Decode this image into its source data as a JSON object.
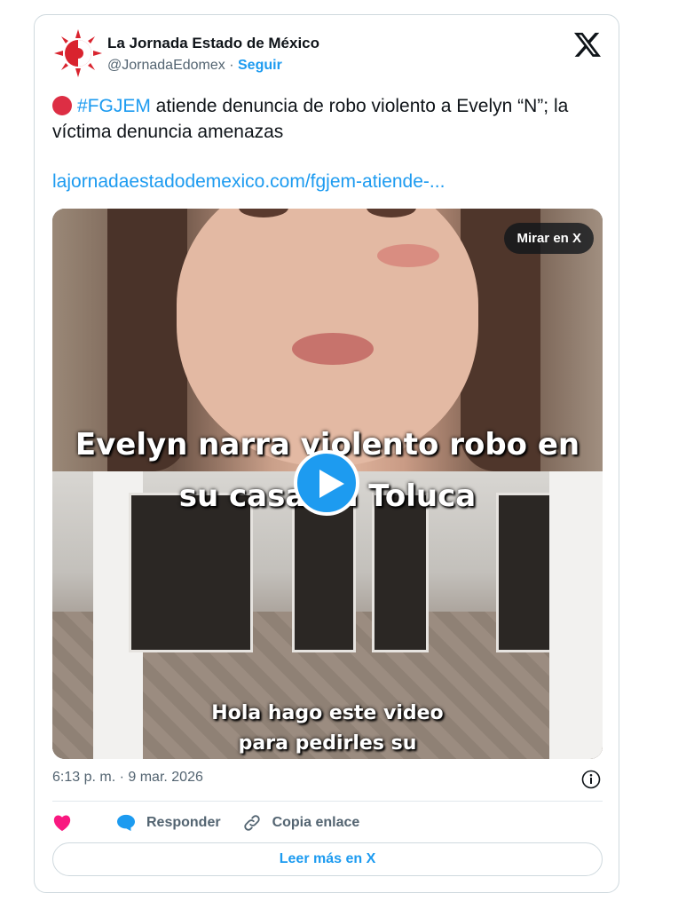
{
  "author": {
    "name": "La Jornada Estado de México",
    "handle": "@JornadaEdomex",
    "separator": "·",
    "follow_label": "Seguir"
  },
  "post": {
    "hashtag": "#FGJEM",
    "text": " atiende denuncia de robo violento a Evelyn “N”; la víctima denuncia amenazas",
    "link": "lajornadaestadodemexico.com/fgjem-atiende-..."
  },
  "media": {
    "watch_label": "Mirar en X",
    "caption_line1": "Evelyn narra violento robo en",
    "caption_line2": "su casa en Toluca",
    "subtitle": "Hola hago este video para pedirles su ayuda"
  },
  "timestamp": "6:13 p. m. · 9 mar. 2026",
  "actions": {
    "reply_label": "Responder",
    "copy_link_label": "Copia enlace",
    "read_more_label": "Leer más en X"
  },
  "colors": {
    "accent": "#1d9bf0",
    "like": "#f91880",
    "red_dot": "#dd2e44"
  }
}
